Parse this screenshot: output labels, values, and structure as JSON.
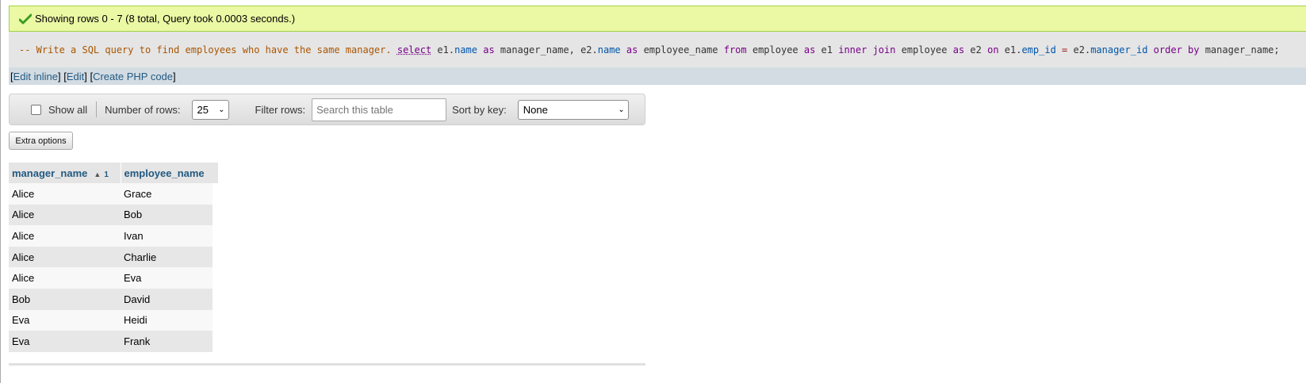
{
  "message": {
    "text": "Showing rows 0 - 7 (8 total, Query took 0.0003 seconds.)",
    "icon": "success-check-icon",
    "color": "#ebf8a4"
  },
  "sql": {
    "comment": "-- Write a SQL query to find employees who have the same manager.",
    "tokens": [
      {
        "t": "select",
        "c": "sel"
      },
      {
        "t": " e1.",
        "c": "plain"
      },
      {
        "t": "name",
        "c": "field"
      },
      {
        "t": " ",
        "c": "plain"
      },
      {
        "t": "as",
        "c": "kw"
      },
      {
        "t": " manager_name, e2.",
        "c": "plain"
      },
      {
        "t": "name",
        "c": "field"
      },
      {
        "t": " ",
        "c": "plain"
      },
      {
        "t": "as",
        "c": "kw"
      },
      {
        "t": " employee_name ",
        "c": "plain"
      },
      {
        "t": "from",
        "c": "kw"
      },
      {
        "t": " employee ",
        "c": "plain"
      },
      {
        "t": "as",
        "c": "kw"
      },
      {
        "t": " e1 ",
        "c": "plain"
      },
      {
        "t": "inner join",
        "c": "kw"
      },
      {
        "t": " employee ",
        "c": "plain"
      },
      {
        "t": "as",
        "c": "kw"
      },
      {
        "t": " e2 ",
        "c": "plain"
      },
      {
        "t": "on",
        "c": "kw"
      },
      {
        "t": " e1.",
        "c": "plain"
      },
      {
        "t": "emp_id",
        "c": "field"
      },
      {
        "t": " ",
        "c": "plain"
      },
      {
        "t": "=",
        "c": "op"
      },
      {
        "t": " e2.",
        "c": "plain"
      },
      {
        "t": "manager_id",
        "c": "field"
      },
      {
        "t": " ",
        "c": "plain"
      },
      {
        "t": "order by",
        "c": "kw"
      },
      {
        "t": " manager_name;",
        "c": "plain"
      }
    ]
  },
  "links": {
    "edit_inline": "Edit inline",
    "edit": "Edit",
    "create_php": "Create PHP code"
  },
  "nav": {
    "show_all_label": "Show all",
    "show_all_checked": false,
    "rows_label": "Number of rows:",
    "rows_value": "25",
    "filter_label": "Filter rows:",
    "filter_placeholder": "Search this table",
    "sort_label": "Sort by key:",
    "sort_value": "None"
  },
  "extra_options_label": "Extra options",
  "table": {
    "columns": [
      {
        "name": "manager_name",
        "sort_indicator": "▲",
        "sort_order": "1"
      },
      {
        "name": "employee_name"
      }
    ],
    "rows": [
      [
        "Alice",
        "Grace"
      ],
      [
        "Alice",
        "Bob"
      ],
      [
        "Alice",
        "Ivan"
      ],
      [
        "Alice",
        "Charlie"
      ],
      [
        "Alice",
        "Eva"
      ],
      [
        "Bob",
        "David"
      ],
      [
        "Eva",
        "Heidi"
      ],
      [
        "Eva",
        "Frank"
      ]
    ]
  }
}
